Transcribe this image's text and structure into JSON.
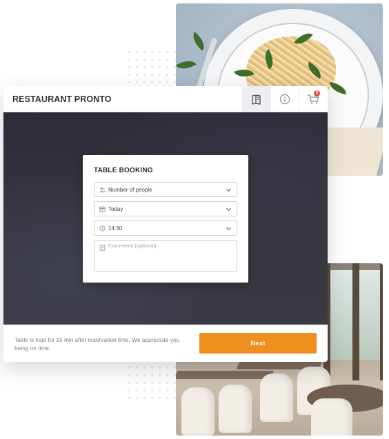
{
  "header": {
    "title": "RESTAURANT PRONTO",
    "cart_count": "2",
    "icons": [
      "menu-book-icon",
      "info-icon",
      "cart-icon"
    ]
  },
  "booking": {
    "title": "TABLE BOOKING",
    "people": {
      "value": "Number of people",
      "icon": "people-icon"
    },
    "date": {
      "value": "Today",
      "icon": "calendar-icon"
    },
    "time": {
      "value": "14:30",
      "icon": "clock-icon"
    },
    "comments": {
      "placeholder": "Comments (optional)",
      "icon": "note-icon"
    }
  },
  "footer": {
    "note": "Table is kept for 15 min after reservation time. We appreciate you being on time.",
    "next_label": "Next"
  },
  "colors": {
    "accent": "#ee8f1e",
    "badge": "#e24b3b",
    "hero_bg": "#2f2f3a"
  }
}
